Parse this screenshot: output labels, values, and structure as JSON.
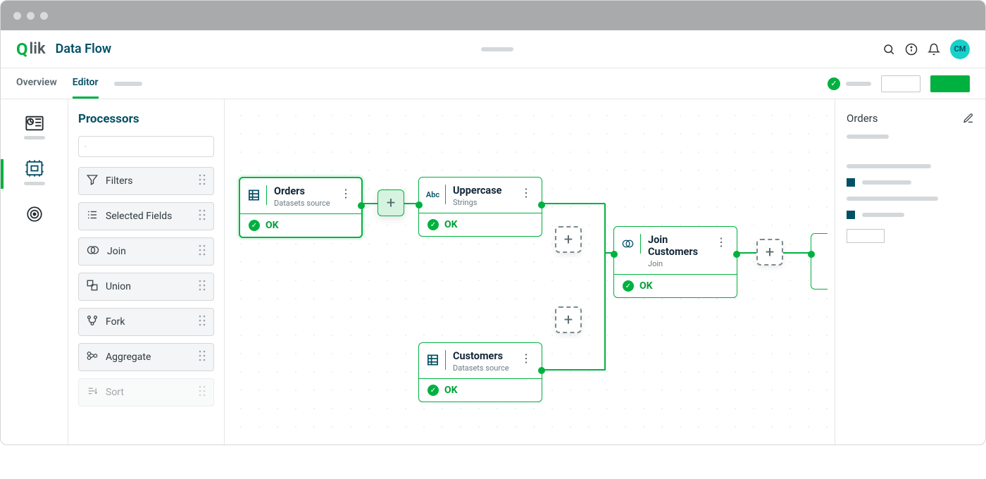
{
  "header": {
    "brand_q": "Q",
    "brand_rest": "lik",
    "page_title": "Data Flow",
    "avatar": "CM"
  },
  "tabs": {
    "overview": "Overview",
    "editor": "Editor"
  },
  "rail": {
    "items": [
      "datasets",
      "processors",
      "targets"
    ],
    "active_index": 1
  },
  "sidebar": {
    "title": "Processors",
    "search_placeholder": "",
    "processors": [
      {
        "key": "filters",
        "label": "Filters",
        "icon": "funnel"
      },
      {
        "key": "selected-fields",
        "label": "Selected Fields",
        "icon": "fields"
      },
      {
        "key": "join",
        "label": "Join",
        "icon": "join"
      },
      {
        "key": "union",
        "label": "Union",
        "icon": "union"
      },
      {
        "key": "fork",
        "label": "Fork",
        "icon": "fork"
      },
      {
        "key": "aggregate",
        "label": "Aggregate",
        "icon": "aggregate"
      },
      {
        "key": "sort",
        "label": "Sort",
        "icon": "sort",
        "muted": true
      }
    ]
  },
  "nodes": {
    "orders": {
      "title": "Orders",
      "subtitle": "Datasets source",
      "status": "OK",
      "icon": "table",
      "selected": true
    },
    "uppercase": {
      "title": "Uppercase",
      "subtitle": "Strings",
      "status": "OK",
      "icon": "abc"
    },
    "customers": {
      "title": "Customers",
      "subtitle": "Datasets source",
      "status": "OK",
      "icon": "table"
    },
    "join": {
      "title": "Join Customers",
      "subtitle": "Join",
      "status": "OK",
      "icon": "join"
    }
  },
  "right_panel": {
    "title": "Orders"
  },
  "colors": {
    "accent": "#00b140",
    "brand": "#035066"
  }
}
